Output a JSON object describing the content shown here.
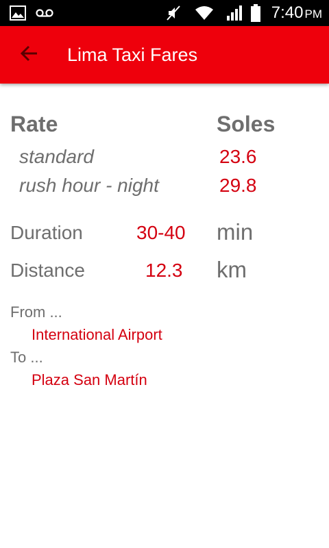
{
  "status_bar": {
    "time": "7:40",
    "ampm": "PM",
    "icons": [
      "image-icon",
      "voicemail-icon",
      "mute-icon",
      "wifi-icon",
      "signal-icon",
      "battery-icon"
    ]
  },
  "app_bar": {
    "title": "Lima Taxi Fares",
    "back_icon": "arrow-back-icon"
  },
  "rates": {
    "header_rate": "Rate",
    "header_currency": "Soles",
    "rows": [
      {
        "label": "standard",
        "value": "23.6"
      },
      {
        "label": "rush hour - night",
        "value": "29.8"
      }
    ]
  },
  "duration": {
    "label": "Duration",
    "value": "30-40",
    "unit": "min"
  },
  "distance": {
    "label": "Distance",
    "value": "12.3",
    "unit": "km"
  },
  "route": {
    "from_label": "From ...",
    "from_value": "International Airport",
    "to_label": "To ...",
    "to_value": "Plaza San Martín"
  },
  "colors": {
    "accent": "#ee000c",
    "value_red": "#d40010",
    "text_gray": "#6e6e6e"
  }
}
